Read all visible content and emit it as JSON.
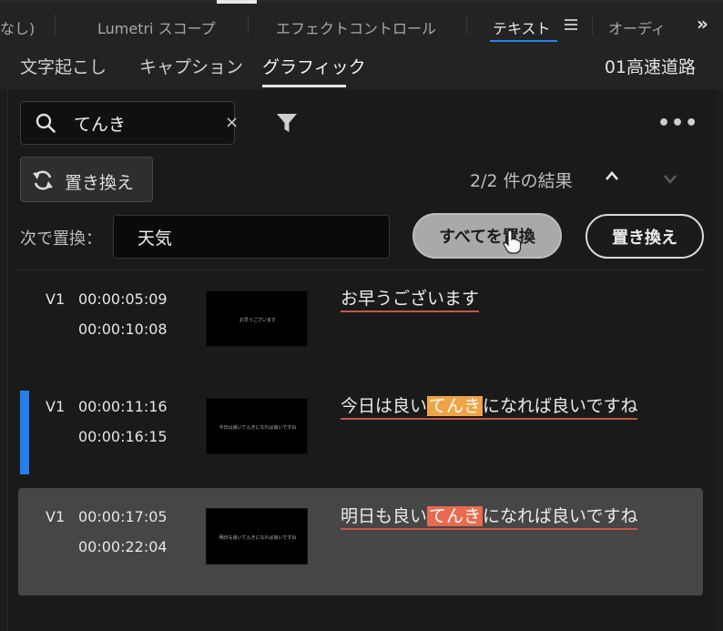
{
  "panel_tabs": {
    "items": [
      {
        "label": "なし)"
      },
      {
        "label": "Lumetri スコープ"
      },
      {
        "label": "エフェクトコントロール"
      },
      {
        "label": "テキスト"
      },
      {
        "label": "オーディ"
      }
    ],
    "overflow": "»"
  },
  "sub_tabs": {
    "items": [
      {
        "label": "文字起こし"
      },
      {
        "label": "キャプション"
      },
      {
        "label": "グラフィック"
      }
    ],
    "sequence_name": "01高速道路"
  },
  "search": {
    "value": "てんき",
    "clear": "×"
  },
  "toolbar": {
    "replace_label": "置き換え",
    "more": "•••"
  },
  "results": {
    "count_text": "2/2 件の結果"
  },
  "replace": {
    "label": "次で置換：",
    "value": "天気",
    "replace_all_label": "すべてを置換",
    "replace_label": "置き換え"
  },
  "rows": [
    {
      "track": "V1",
      "tc_in": "00:00:05:09",
      "tc_out": "00:00:10:08",
      "thumb_text": "お早うございます",
      "pre": "お早うございます",
      "match": "",
      "post": ""
    },
    {
      "track": "V1",
      "tc_in": "00:00:11:16",
      "tc_out": "00:00:16:15",
      "thumb_text": "今日は良いてんきになれば良いですね",
      "pre": "今日は良い",
      "match": "てんき",
      "post": "になれば良いですね"
    },
    {
      "track": "V1",
      "tc_in": "00:00:17:05",
      "tc_out": "00:00:22:04",
      "thumb_text": "明日も良いてんきになれば良いですね",
      "pre": "明日も良い",
      "match": "てんき",
      "post": "になれば良いですね"
    }
  ],
  "colors": {
    "accent": "#2680eb",
    "highlight_current": "#f0a445",
    "highlight_match": "#e86b4f"
  }
}
